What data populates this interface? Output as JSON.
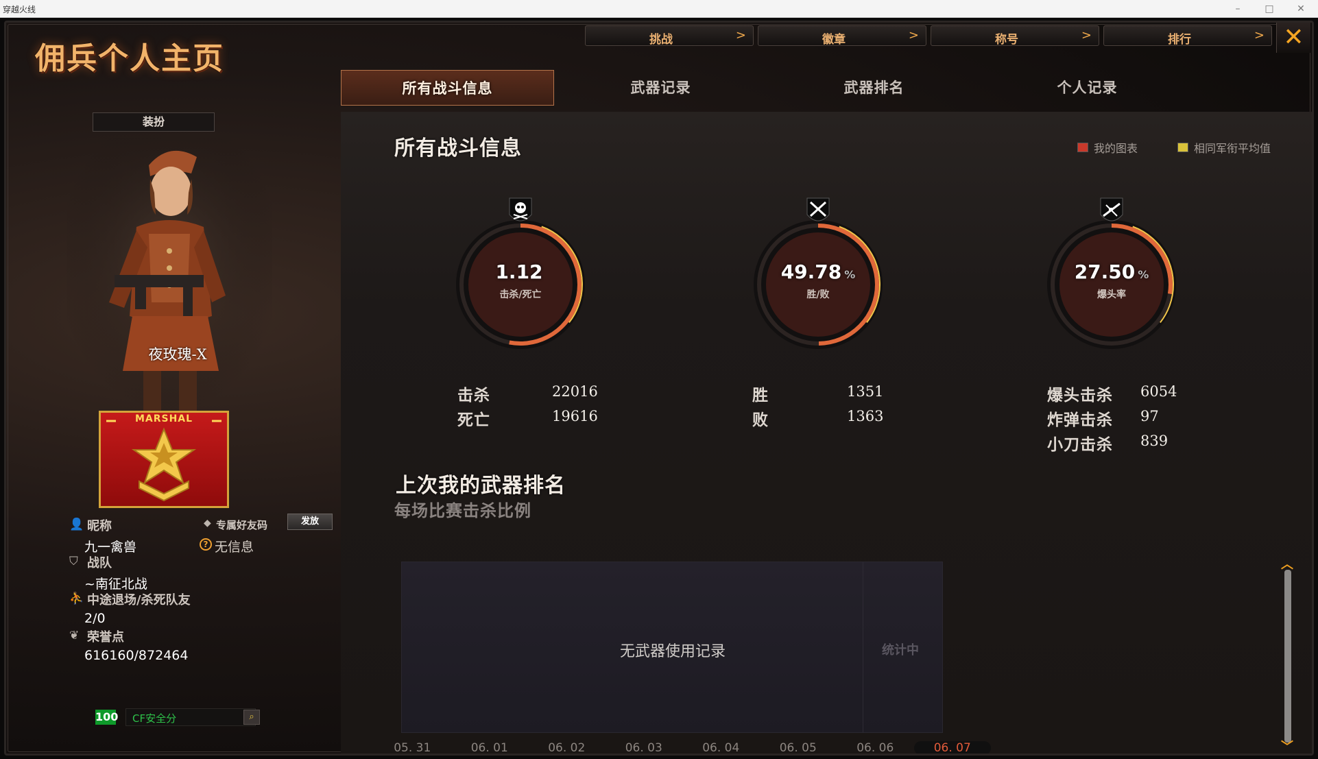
{
  "os": {
    "window_title": "穿越火线"
  },
  "header": {
    "page_title": "佣兵个人主页",
    "nav": [
      {
        "label": "挑战"
      },
      {
        "label": "徽章"
      },
      {
        "label": "称号"
      },
      {
        "label": "排行"
      }
    ],
    "nav_arrow": ">",
    "close_glyph": "✕"
  },
  "tabs": [
    {
      "label": "所有战斗信息",
      "active": true
    },
    {
      "label": "武器记录",
      "active": false
    },
    {
      "label": "武器排名",
      "active": false
    },
    {
      "label": "个人记录",
      "active": false
    }
  ],
  "sidebar": {
    "outfit_button": "装扮",
    "character_name": "夜玫瑰-X",
    "rank_badge_text": "MARSHAL",
    "nickname_label": "昵称",
    "nickname_value": "九一禽兽",
    "friend_code_label": "专属好友码",
    "send_button": "发放",
    "friend_code_value": "无信息",
    "team_label": "战队",
    "team_value": "~南征北战",
    "quit_label": "中途退场/杀死队友",
    "quit_value": "2/0",
    "honor_label": "荣誉点",
    "honor_value": "616160/872464",
    "security_score": "100",
    "security_label": "CF安全分"
  },
  "battle_info": {
    "title": "所有战斗信息",
    "legend": [
      {
        "label": "我的图表",
        "color": "#c8392b"
      },
      {
        "label": "相同军衔平均值",
        "color": "#d9c23a"
      }
    ],
    "gauges": [
      {
        "value": "1.12",
        "unit": "",
        "label": "击杀/死亡",
        "fraction": 0.53,
        "icon": "skull-icon"
      },
      {
        "value": "49.78",
        "unit": "%",
        "label": "胜/败",
        "fraction": 0.4978,
        "icon": "crossed-swords-icon"
      },
      {
        "value": "27.50",
        "unit": "%",
        "label": "爆头率",
        "fraction": 0.275,
        "icon": "crossed-rifles-icon"
      }
    ],
    "stats": {
      "kills_label": "击杀",
      "kills": "22016",
      "deaths_label": "死亡",
      "deaths": "19616",
      "wins_label": "胜",
      "wins": "1351",
      "losses_label": "败",
      "losses": "1363",
      "headshot_label": "爆头击杀",
      "headshot": "6054",
      "grenade_label": "炸弹击杀",
      "grenade": "97",
      "knife_label": "小刀击杀",
      "knife": "839"
    }
  },
  "weapon_rank": {
    "title": "上次我的武器排名",
    "subtitle": "每场比赛击杀比例",
    "empty_text": "无武器使用记录",
    "calc_text": "统计中",
    "dates": [
      "05. 31",
      "06. 01",
      "06. 02",
      "06. 03",
      "06. 04",
      "06. 05",
      "06. 06",
      "06. 07"
    ],
    "active_date_index": 7
  }
}
